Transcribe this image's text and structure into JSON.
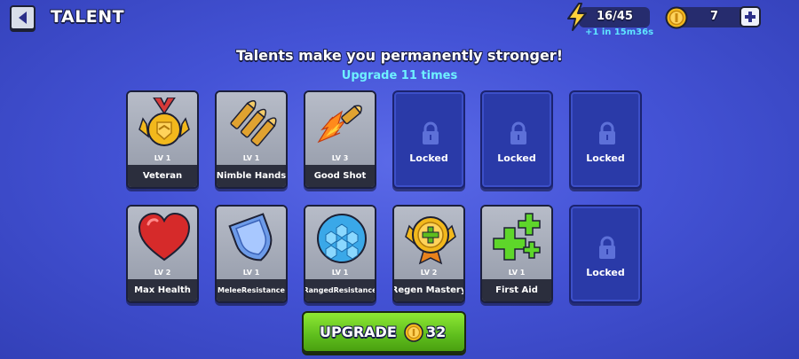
{
  "header": {
    "title": "TALENT",
    "back_icon": "back-arrow-icon",
    "energy": {
      "value": "16/45",
      "timer": "+1 in 15m36s",
      "icon": "lightning-icon"
    },
    "coins": {
      "value": "7",
      "icon": "coin-icon",
      "add_icon": "plus-icon"
    }
  },
  "intro": {
    "headline": "Talents make you permanently stronger!",
    "subline": "Upgrade 11 times"
  },
  "talents": [
    {
      "name": "Veteran",
      "level": "LV 1",
      "locked": false,
      "icon": "medal-icon"
    },
    {
      "name": "Nimble Hands",
      "level": "LV 1",
      "locked": false,
      "icon": "bullets-icon"
    },
    {
      "name": "Good Shot",
      "level": "LV 3",
      "locked": false,
      "icon": "fire-bullet-icon"
    },
    {
      "name": "Locked",
      "locked": true,
      "icon": "lock-icon"
    },
    {
      "name": "Locked",
      "locked": true,
      "icon": "lock-icon"
    },
    {
      "name": "Locked",
      "locked": true,
      "icon": "lock-icon"
    },
    {
      "name": "Max Health",
      "level": "LV 2",
      "locked": false,
      "icon": "heart-icon"
    },
    {
      "name": "MeleeResistance",
      "level": "LV 1",
      "locked": false,
      "icon": "shield-icon"
    },
    {
      "name": "RangedResistance",
      "level": "LV 1",
      "locked": false,
      "icon": "hex-shield-icon"
    },
    {
      "name": "Regen Mastery",
      "level": "LV 2",
      "locked": false,
      "icon": "regen-badge-icon"
    },
    {
      "name": "First Aid",
      "level": "LV 1",
      "locked": false,
      "icon": "green-cross-icon"
    },
    {
      "name": "Locked",
      "locked": true,
      "icon": "lock-icon"
    }
  ],
  "upgrade_button": {
    "label": "UPGRADE",
    "cost": "32",
    "icon": "coin-icon"
  },
  "colors": {
    "accent_cyan": "#6ef0ff",
    "upgrade_green": "#5ebd1d",
    "locked_blue": "#2a3aa8",
    "coin_gold": "#f2b81c"
  }
}
